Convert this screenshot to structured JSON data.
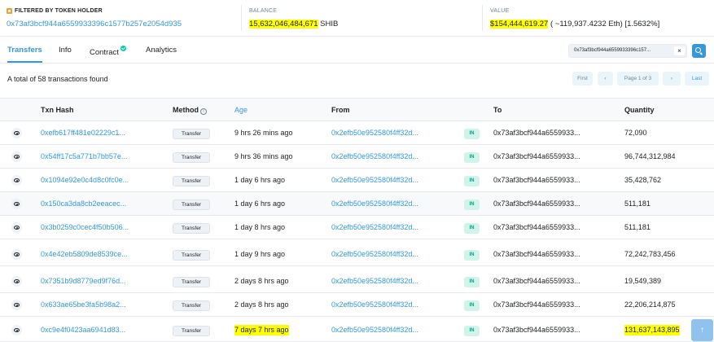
{
  "summary": {
    "filter_label": "FILTERED BY TOKEN HOLDER",
    "holder_address": "0x73af3bcf944a6559933396c1577b257e2054d935",
    "balance_label": "BALANCE",
    "balance_amount": "15,632,046,484,671",
    "balance_unit": "SHIB",
    "value_label": "VALUE",
    "value_amount": "$154,444,619.27",
    "value_detail": "( ~119,937.4232 Eth) [1.5632%]"
  },
  "tabs": [
    {
      "label": "Transfers"
    },
    {
      "label": "Info"
    },
    {
      "label": "Contract"
    },
    {
      "label": "Analytics"
    }
  ],
  "address_filter": {
    "value": "0x73af3bcf944a6559933396c157...",
    "clear": "×"
  },
  "total_text": "A total of 58 transactions found",
  "pager": {
    "first": "First",
    "prev": "‹",
    "page": "Page 1 of 3",
    "next": "›",
    "last": "Last"
  },
  "table": {
    "headers": {
      "txn_hash": "Txn Hash",
      "method": "Method",
      "age": "Age",
      "from": "From",
      "to": "To",
      "quantity": "Quantity"
    },
    "rows": [
      {
        "hash": "0xefb617ff481e02229c1...",
        "method": "Transfer",
        "age": "9 hrs 26 mins ago",
        "from": "0x2efb50e952580f4ff32d...",
        "dir": "IN",
        "to": "0x73af3bcf944a6559933...",
        "qty": "72,090"
      },
      {
        "hash": "0x54ff17c5a771b7bb57e...",
        "method": "Transfer",
        "age": "9 hrs 36 mins ago",
        "from": "0x2efb50e952580f4ff32d...",
        "dir": "IN",
        "to": "0x73af3bcf944a6559933...",
        "qty": "96,744,312,984"
      },
      {
        "hash": "0x1094e92e0c4d8c0fc0e...",
        "method": "Transfer",
        "age": "1 day 6 hrs ago",
        "from": "0x2efb50e952580f4ff32d...",
        "dir": "IN",
        "to": "0x73af3bcf944a6559933...",
        "qty": "35,428,762"
      },
      {
        "hash": "0x150ca3da8cb2eeacec...",
        "method": "Transfer",
        "age": "1 day 6 hrs ago",
        "from": "0x2efb50e952580f4ff32d...",
        "dir": "IN",
        "to": "0x73af3bcf944a6559933...",
        "qty": "511,181"
      },
      {
        "hash": "0x3b0259c0cec4f50b506...",
        "method": "Transfer",
        "age": "1 day 8 hrs ago",
        "from": "0x2efb50e952580f4ff32d...",
        "dir": "IN",
        "to": "0x73af3bcf944a6559933...",
        "qty": "511,181"
      },
      {
        "hash": "0x4e42eb5809de8539ce...",
        "method": "Transfer",
        "age": "1 day 9 hrs ago",
        "from": "0x2efb50e952580f4ff32d...",
        "dir": "IN",
        "to": "0x73af3bcf944a6559933...",
        "qty": "72,242,783,456"
      },
      {
        "hash": "0x7351b9d8779ed9f76d...",
        "method": "Transfer",
        "age": "2 days 8 hrs ago",
        "from": "0x2efb50e952580f4ff32d...",
        "dir": "IN",
        "to": "0x73af3bcf944a6559933...",
        "qty": "19,549,389"
      },
      {
        "hash": "0x633ae65be3fa5b98a2...",
        "method": "Transfer",
        "age": "2 days 8 hrs ago",
        "from": "0x2efb50e952580f4ff32d...",
        "dir": "IN",
        "to": "0x73af3bcf944a6559933...",
        "qty": "22,206,214,875"
      },
      {
        "hash": "0xc9e4f0423aa6941d83...",
        "method": "Transfer",
        "age": "7 days 7 hrs ago",
        "from": "0x2efb50e952580f4ff32d...",
        "dir": "IN",
        "to": "0x73af3bcf944a6559933...",
        "qty": "131,637,143,895"
      }
    ]
  },
  "scroll_top": "↑",
  "colors": {
    "accent": "#3498db",
    "highlight": "#ffff00",
    "in_badge": "#00a186"
  }
}
